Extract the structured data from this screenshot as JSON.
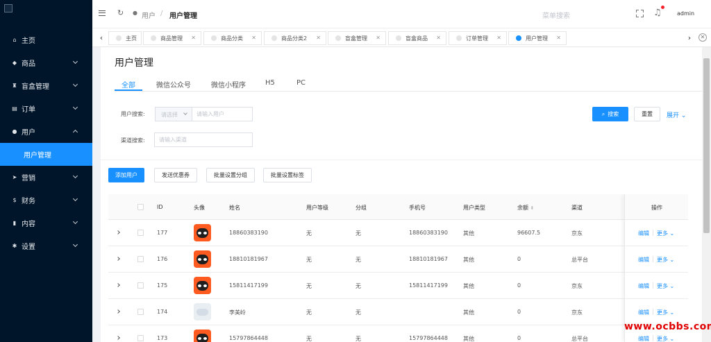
{
  "sidebar": {
    "items": [
      {
        "label": "主页",
        "icon": "home-icon",
        "glyph": "⌂"
      },
      {
        "label": "商品",
        "icon": "shopping-bag-icon",
        "glyph": "◆"
      },
      {
        "label": "盲盒管理",
        "icon": "trophy-icon",
        "glyph": "♜"
      },
      {
        "label": "订单",
        "icon": "cart-icon",
        "glyph": "▤"
      },
      {
        "label": "用户",
        "icon": "user-icon",
        "glyph": "●"
      },
      {
        "label": "用户管理",
        "icon": "",
        "glyph": ""
      },
      {
        "label": "营销",
        "icon": "send-icon",
        "glyph": "➤"
      },
      {
        "label": "财务",
        "icon": "dollar-icon",
        "glyph": "$"
      },
      {
        "label": "内容",
        "icon": "book-icon",
        "glyph": "▮"
      },
      {
        "label": "设置",
        "icon": "gear-icon",
        "glyph": "✱"
      }
    ]
  },
  "header": {
    "breadcrumb_parent": "用户",
    "breadcrumb_sep": "/",
    "breadcrumb_current": "用户管理",
    "menu_search_placeholder": "菜单搜索",
    "user_name": "admin"
  },
  "tabs": [
    {
      "label": "主页"
    },
    {
      "label": "商品管理"
    },
    {
      "label": "商品分类"
    },
    {
      "label": "商品分类2"
    },
    {
      "label": "盲盒管理"
    },
    {
      "label": "盲盒商品"
    },
    {
      "label": "订单管理"
    },
    {
      "label": "用户管理"
    }
  ],
  "page": {
    "title": "用户管理",
    "subtabs": [
      "全部",
      "微信公众号",
      "微信小程序",
      "H5",
      "PC"
    ]
  },
  "search": {
    "user_label": "用户搜索:",
    "select_placeholder": "请选择",
    "user_placeholder": "请输入用户",
    "channel_label": "渠道搜索:",
    "channel_placeholder": "请输入渠道",
    "search_button": "搜索",
    "reset_button": "重置",
    "expand_label": "展开"
  },
  "actions": {
    "add_user": "添加用户",
    "send_coupon": "发送优惠券",
    "batch_group": "批量设置分组",
    "batch_tag": "批量设置标签"
  },
  "table": {
    "columns": {
      "id": "ID",
      "avatar": "头像",
      "name": "姓名",
      "level": "用户等级",
      "group": "分组",
      "phone": "手机号",
      "type": "用户类型",
      "balance": "余额",
      "channel": "渠道",
      "ops": "操作"
    },
    "rows": [
      {
        "id": "177",
        "name": "18860383190",
        "level": "无",
        "group": "无",
        "phone": "18860383190",
        "type": "其他",
        "balance": "96607.5",
        "channel": "京东",
        "avatar": "cat"
      },
      {
        "id": "176",
        "name": "18810181967",
        "level": "无",
        "group": "无",
        "phone": "18810181967",
        "type": "其他",
        "balance": "0",
        "channel": "总平台",
        "avatar": "cat"
      },
      {
        "id": "175",
        "name": "15811417199",
        "level": "无",
        "group": "无",
        "phone": "15811417199",
        "type": "其他",
        "balance": "0",
        "channel": "京东",
        "avatar": "cat"
      },
      {
        "id": "174",
        "name": "李美岭",
        "level": "无",
        "group": "无",
        "phone": "",
        "type": "其他",
        "balance": "0",
        "channel": "京东",
        "avatar": "pale"
      },
      {
        "id": "173",
        "name": "15797864448",
        "level": "无",
        "group": "无",
        "phone": "15797864448",
        "type": "其他",
        "balance": "0",
        "channel": "总平台",
        "avatar": "cat"
      }
    ],
    "op_edit": "编辑",
    "op_more": "更多"
  },
  "watermark": "www.ocbbs.com",
  "colors": {
    "accent": "#1890ff",
    "sidebar_bg": "#001529",
    "notify": "#f5222d"
  }
}
